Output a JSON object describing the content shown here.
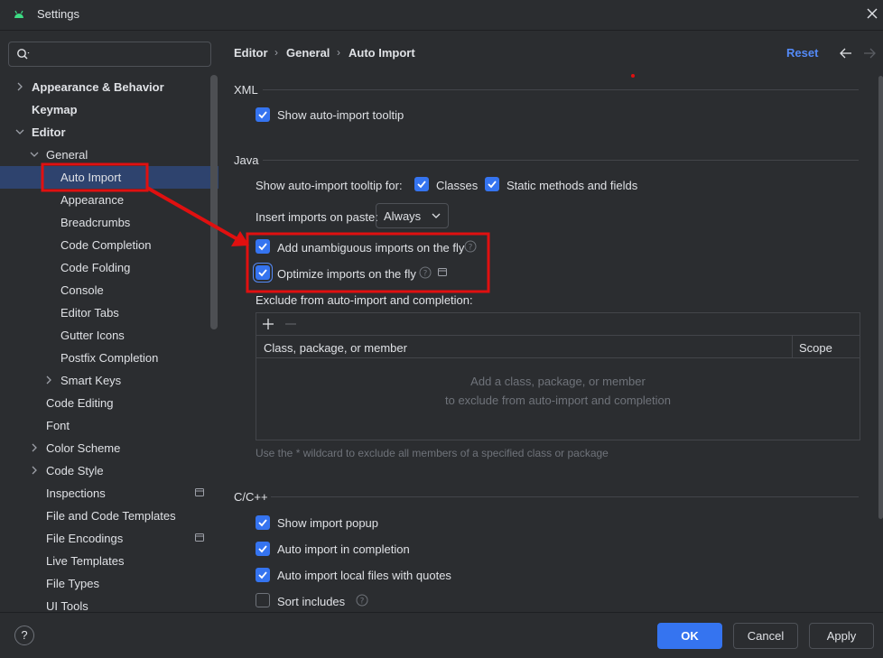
{
  "window": {
    "title": "Settings"
  },
  "search": {
    "placeholder": "",
    "value": ""
  },
  "sidebar": {
    "items": [
      {
        "label": "Appearance & Behavior"
      },
      {
        "label": "Keymap"
      },
      {
        "label": "Editor"
      },
      {
        "label": "General"
      },
      {
        "label": "Auto Import"
      },
      {
        "label": "Appearance"
      },
      {
        "label": "Breadcrumbs"
      },
      {
        "label": "Code Completion"
      },
      {
        "label": "Code Folding"
      },
      {
        "label": "Console"
      },
      {
        "label": "Editor Tabs"
      },
      {
        "label": "Gutter Icons"
      },
      {
        "label": "Postfix Completion"
      },
      {
        "label": "Smart Keys"
      },
      {
        "label": "Code Editing"
      },
      {
        "label": "Font"
      },
      {
        "label": "Color Scheme"
      },
      {
        "label": "Code Style"
      },
      {
        "label": "Inspections"
      },
      {
        "label": "File and Code Templates"
      },
      {
        "label": "File Encodings"
      },
      {
        "label": "Live Templates"
      },
      {
        "label": "File Types"
      },
      {
        "label": "UI Tools"
      }
    ]
  },
  "breadcrumb": [
    "Editor",
    "General",
    "Auto Import"
  ],
  "header": {
    "reset_label": "Reset"
  },
  "xml": {
    "title": "XML",
    "show_tooltip": "Show auto-import tooltip"
  },
  "java": {
    "title": "Java",
    "tooltip_for_label": "Show auto-import tooltip for:",
    "classes": "Classes",
    "static_methods": "Static methods and fields",
    "insert_label": "Insert imports on paste:",
    "insert_value": "Always",
    "add_unambiguous": "Add unambiguous imports on the fly",
    "optimize": "Optimize imports on the fly",
    "exclude_label": "Exclude from auto-import and completion:",
    "table_col_1": "Class, package, or member",
    "table_col_2": "Scope",
    "empty_line_1": "Add a class, package, or member",
    "empty_line_2": "to exclude from auto-import and completion",
    "hint": "Use the * wildcard to exclude all members of a specified class or package"
  },
  "cpp": {
    "title": "C/C++",
    "show_popup": "Show import popup",
    "auto_import_completion": "Auto import in completion",
    "local_files_quotes": "Auto import local files with quotes",
    "sort_includes": "Sort includes"
  },
  "footer": {
    "help": "?",
    "ok": "OK",
    "cancel": "Cancel",
    "apply": "Apply"
  },
  "colors": {
    "accent": "#3574f0",
    "link": "#548af7",
    "annotation_red": "#e01010",
    "background": "#2b2d30",
    "selection": "#2e436e"
  }
}
